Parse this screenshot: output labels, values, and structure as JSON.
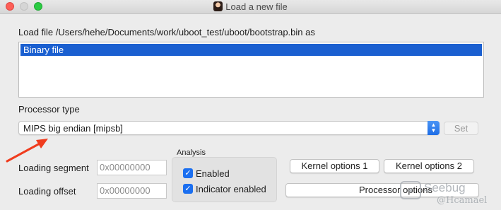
{
  "window": {
    "title": "Load a new file"
  },
  "load_file": {
    "label": "Load file /Users/hehe/Documents/work/uboot_test/uboot/bootstrap.bin as",
    "options": [
      "Binary file"
    ],
    "selected": "Binary file"
  },
  "processor": {
    "label": "Processor type",
    "value": "MIPS big endian [mipsb]",
    "set_label": "Set"
  },
  "analysis": {
    "label": "Analysis",
    "enabled_label": "Enabled",
    "enabled_checked": true,
    "indicator_label": "Indicator enabled",
    "indicator_checked": true
  },
  "loading": {
    "segment_label": "Loading segment",
    "segment_value": "0x00000000",
    "offset_label": "Loading offset",
    "offset_value": "0x00000000"
  },
  "buttons": {
    "kernel1": "Kernel options 1",
    "kernel2": "Kernel options 2",
    "processor_options": "Processor options"
  },
  "watermark": {
    "brand": "Seebug",
    "user": "@Hcamael"
  },
  "colors": {
    "selection": "#1a5fd0",
    "checkbox": "#1b6ff0",
    "annotation_arrow": "#f03c1e"
  }
}
